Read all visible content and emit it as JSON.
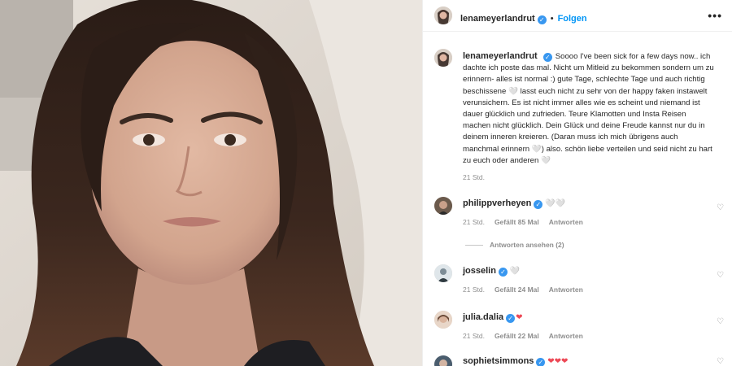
{
  "post": {
    "username": "lenameyerlandrut",
    "follow_label": "Folgen",
    "dot": "•",
    "more_label": "•••",
    "verified_mark": "✓",
    "caption": "Soooo I've been sick for a few days now.. ich dachte ich poste das mal. Nicht um Mitleid zu bekommen sondern um zu erinnern- alles ist normal :) gute Tage, schlechte Tage und auch richtig beschissene 🤍 lasst euch nicht zu sehr von der happy faken instawelt verunsichern. Es ist nicht immer alles wie es scheint und niemand ist dauer glücklich und zufrieden. Teure Klamotten und Insta Reisen machen nicht glücklich. Dein Glück und deine Freude kannst nur du in deinem inneren kreieren. (Daran muss ich mich übrigens auch manchmal erinnern 🤍) also. schön liebe verteilen und seid nicht zu hart zu euch oder anderen 🤍",
    "time": "21 Std."
  },
  "comments": [
    {
      "username": "philippverheyen",
      "text": "🤍🤍",
      "time": "21 Std.",
      "likes": "Gefällt 85 Mal",
      "reply": "Antworten"
    },
    {
      "username": "josselin",
      "text": "🤍",
      "time": "21 Std.",
      "likes": "Gefällt 24 Mal",
      "reply": "Antworten"
    },
    {
      "username": "julia.dalia",
      "text": "❤",
      "time": "21 Std.",
      "likes": "Gefällt 22 Mal",
      "reply": "Antworten"
    },
    {
      "username": "sophietsimmons",
      "text": "❤❤❤",
      "time": "",
      "likes": "",
      "reply": ""
    }
  ],
  "view_replies": "Antworten ansehen (2)",
  "icons": {
    "heart": "♡",
    "verified": "verified-badge-icon",
    "more": "more-options-icon"
  },
  "colors": {
    "accent": "#0095f6",
    "verified": "#3897f0",
    "secondary_text": "#8e8e8e"
  }
}
